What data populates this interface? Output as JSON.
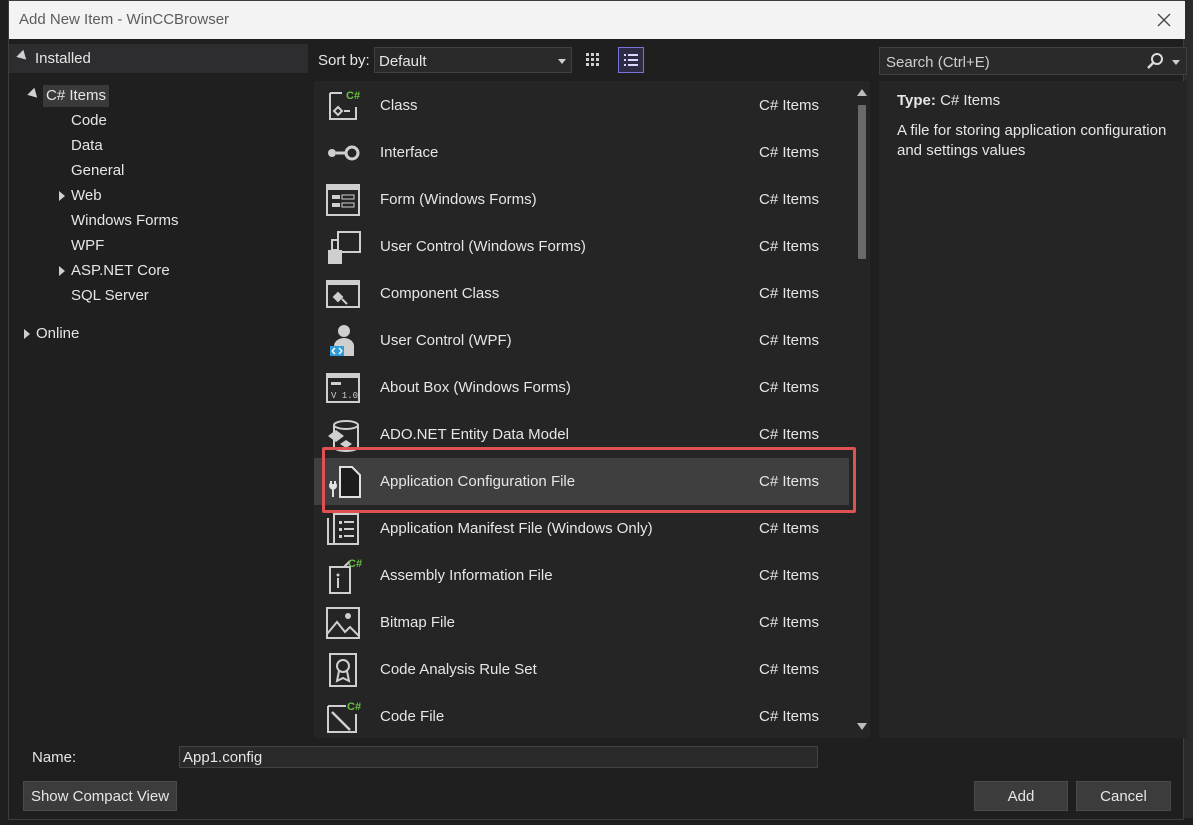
{
  "window": {
    "title": "Add New Item - WinCCBrowser"
  },
  "left": {
    "installed_label": "Installed",
    "tree": [
      {
        "label": "C# Items",
        "level": 1,
        "expander": "expanded",
        "selected": true
      },
      {
        "label": "Code",
        "level": 2
      },
      {
        "label": "Data",
        "level": 2
      },
      {
        "label": "General",
        "level": 2
      },
      {
        "label": "Web",
        "level": 2,
        "expander": "collapsed"
      },
      {
        "label": "Windows Forms",
        "level": 2
      },
      {
        "label": "WPF",
        "level": 2
      },
      {
        "label": "ASP.NET Core",
        "level": 2,
        "expander": "collapsed"
      },
      {
        "label": "SQL Server",
        "level": 2
      }
    ],
    "online_label": "Online"
  },
  "toolbar": {
    "sort_label": "Sort by:",
    "sort_value": "Default",
    "grid_view_icon": "grid-view-icon",
    "list_view_icon": "list-view-icon"
  },
  "items": [
    {
      "name": "Class",
      "category": "C# Items",
      "icon": "class-icon"
    },
    {
      "name": "Interface",
      "category": "C# Items",
      "icon": "interface-icon"
    },
    {
      "name": "Form (Windows Forms)",
      "category": "C# Items",
      "icon": "form-icon"
    },
    {
      "name": "User Control (Windows Forms)",
      "category": "C# Items",
      "icon": "user-control-icon"
    },
    {
      "name": "Component Class",
      "category": "C# Items",
      "icon": "component-class-icon"
    },
    {
      "name": "User Control (WPF)",
      "category": "C# Items",
      "icon": "wpf-user-control-icon"
    },
    {
      "name": "About Box (Windows Forms)",
      "category": "C# Items",
      "icon": "about-box-icon"
    },
    {
      "name": "ADO.NET Entity Data Model",
      "category": "C# Items",
      "icon": "entity-data-model-icon"
    },
    {
      "name": "Application Configuration File",
      "category": "C# Items",
      "icon": "config-file-icon",
      "selected": true
    },
    {
      "name": "Application Manifest File (Windows Only)",
      "category": "C# Items",
      "icon": "manifest-file-icon"
    },
    {
      "name": "Assembly Information File",
      "category": "C# Items",
      "icon": "assembly-info-icon"
    },
    {
      "name": "Bitmap File",
      "category": "C# Items",
      "icon": "bitmap-file-icon"
    },
    {
      "name": "Code Analysis Rule Set",
      "category": "C# Items",
      "icon": "rule-set-icon"
    },
    {
      "name": "Code File",
      "category": "C# Items",
      "icon": "code-file-icon"
    }
  ],
  "search": {
    "placeholder": "Search (Ctrl+E)"
  },
  "details": {
    "type_label": "Type:",
    "type_value": "C# Items",
    "description": "A file for storing application configuration and settings values"
  },
  "bottom": {
    "name_label": "Name:",
    "name_value": "App1.config",
    "compact_view_label": "Show Compact View",
    "add_label": "Add",
    "cancel_label": "Cancel"
  },
  "colors": {
    "highlight_border": "#e05252",
    "active_view_border": "#7a74d6",
    "csharp_badge": "#6abf40"
  }
}
